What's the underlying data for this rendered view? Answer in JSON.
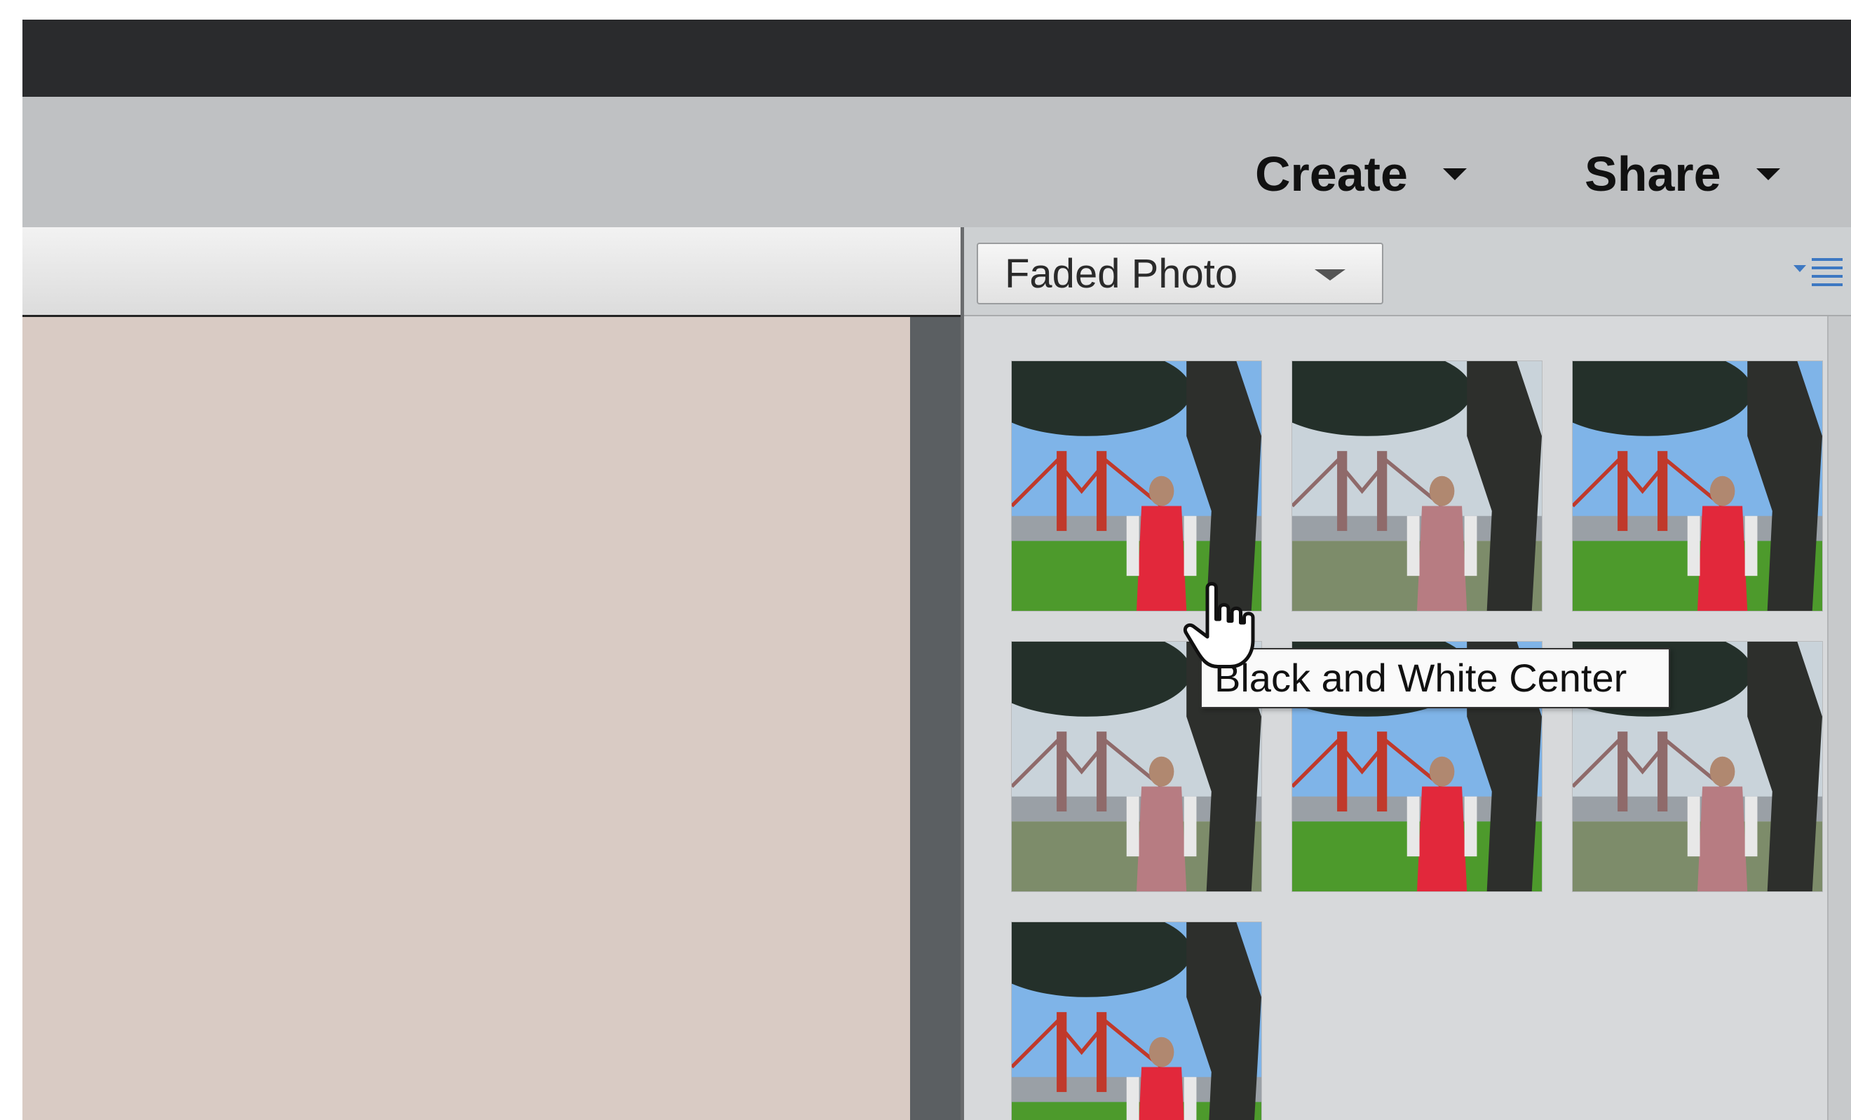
{
  "toolbar": {
    "create_label": "Create",
    "share_label": "Share"
  },
  "effects_panel": {
    "preset_selected": "Faded Photo",
    "menu_icon": "panel-options-menu-icon",
    "thumbnails": [
      {
        "style": "color"
      },
      {
        "style": "faded"
      },
      {
        "style": "color"
      },
      {
        "style": "faded"
      },
      {
        "style": "color"
      },
      {
        "style": "faded"
      },
      {
        "style": "color"
      }
    ],
    "tooltip": "Black and White Center"
  },
  "colors": {
    "titlebar": "#2a2b2d",
    "actionbar": "#bfc1c3",
    "canvas": "#d9cbc4",
    "panel": "#d7d9db"
  }
}
